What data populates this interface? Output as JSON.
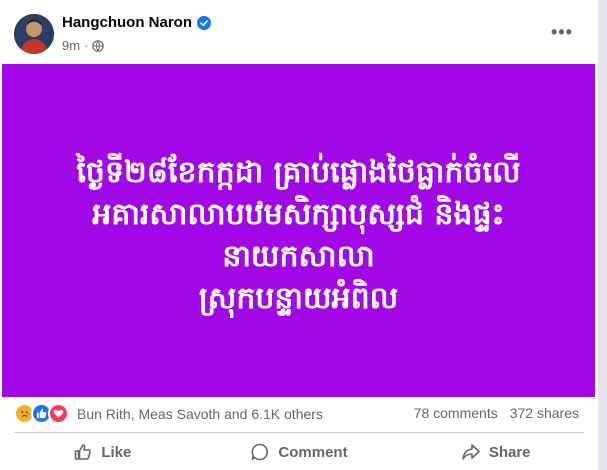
{
  "post": {
    "author": "Hangchuon Naron",
    "time": "9m",
    "more_label": "•••",
    "background_color": "#a207e6",
    "lines": [
      "ថ្ងៃទី២៨ខែកក្កដា គ្រាប់ផ្លោងថៃធ្លាក់ចំលើ",
      "អគារសាលាបឋមសិក្សាបុស្សជំ និងផ្ទះ",
      "នាយកសាលា",
      "ស្រុកបន្ទាយអំពិល"
    ]
  },
  "engagement": {
    "reactors": "Bun Rith, Meas Savoth and 6.1K others",
    "comments": "78 comments",
    "shares": "372 shares",
    "reaction_icons": [
      "sad-reaction",
      "like-reaction",
      "love-reaction"
    ]
  },
  "actions": {
    "like": "Like",
    "comment": "Comment",
    "share": "Share"
  }
}
